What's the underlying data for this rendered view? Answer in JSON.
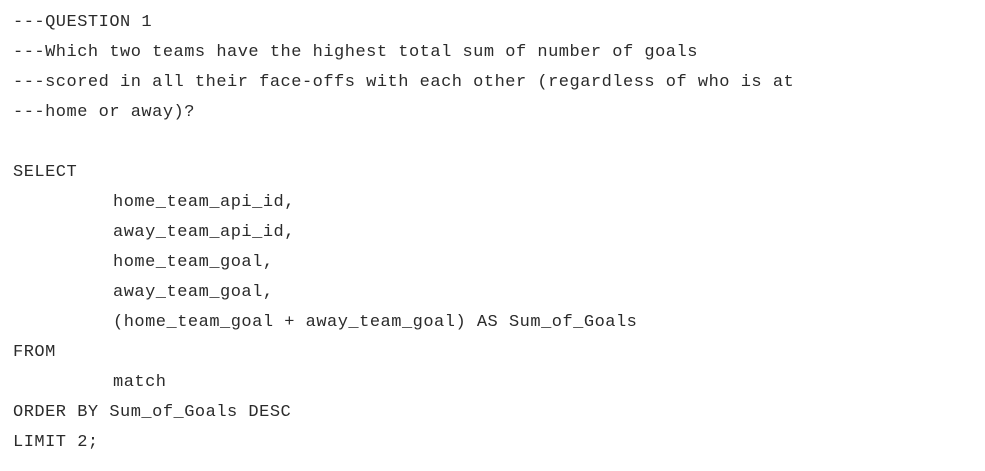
{
  "editor": {
    "lines": [
      {
        "text": "---QUESTION 1",
        "indent": false
      },
      {
        "text": "---Which two teams have the highest total sum of number of goals",
        "indent": false
      },
      {
        "text": "---scored in all their face-offs with each other (regardless of who is at",
        "indent": false
      },
      {
        "text": "---home or away)?",
        "indent": false
      },
      {
        "text": "",
        "indent": false
      },
      {
        "text": "SELECT",
        "indent": false
      },
      {
        "text": "home_team_api_id,",
        "indent": true
      },
      {
        "text": "away_team_api_id,",
        "indent": true
      },
      {
        "text": "home_team_goal,",
        "indent": true
      },
      {
        "text": "away_team_goal,",
        "indent": true
      },
      {
        "text": "(home_team_goal + away_team_goal) AS Sum_of_Goals",
        "indent": true
      },
      {
        "text": "FROM",
        "indent": false
      },
      {
        "text": "match",
        "indent": true
      },
      {
        "text": "ORDER BY Sum_of_Goals DESC",
        "indent": false
      },
      {
        "text": "LIMIT 2;",
        "indent": false
      }
    ]
  }
}
